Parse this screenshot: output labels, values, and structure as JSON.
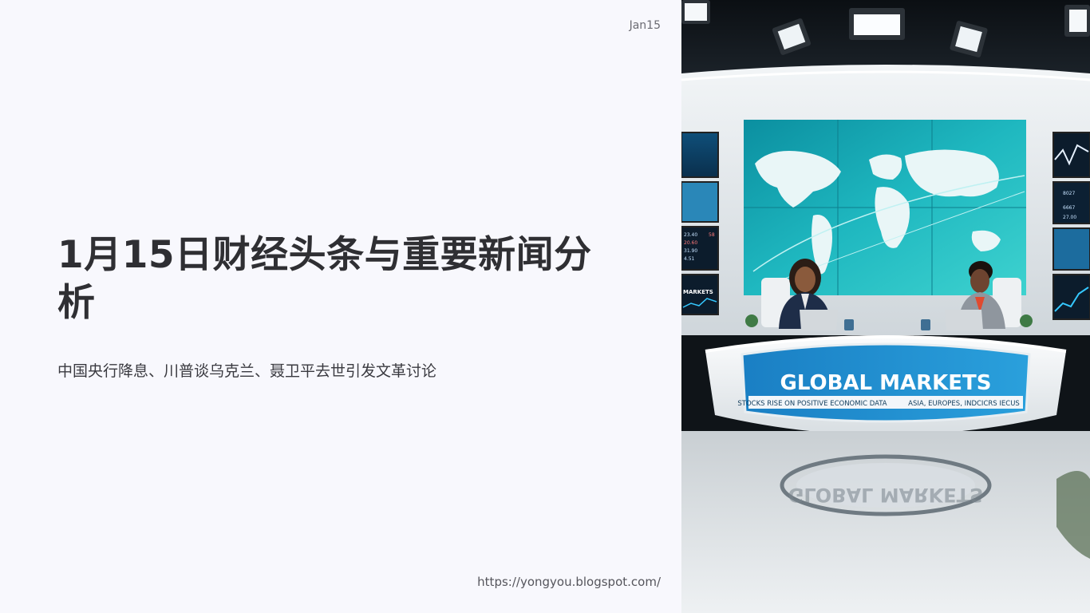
{
  "slide": {
    "date": "Jan15",
    "title": "1月15日财经头条与重要新闻分析",
    "subtitle": "中国央行降息、川普谈乌克兰、聂卫平去世引发文革讨论",
    "url": "https://yongyou.blogspot.com/"
  },
  "photo": {
    "desk_banner_title": "GLOBAL MARKETS",
    "ticker_left": "STOCKS RISE ON POSITIVE ECONOMIC DATA",
    "ticker_right": "ASIA, EUROPES, INDCICRS IECUS",
    "side_monitor_label": "MARKETS",
    "floor_reflection": "GLOBAL MARKETS"
  }
}
